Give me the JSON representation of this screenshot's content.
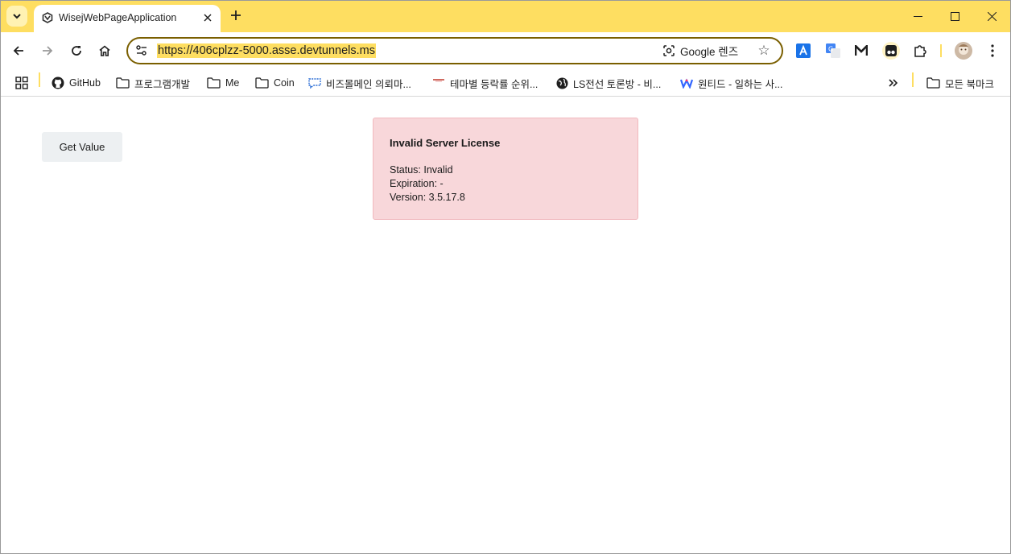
{
  "browser": {
    "tab": {
      "title": "WisejWebPageApplication"
    },
    "address_bar": {
      "url": "https://406cplzz-5000.asse.devtunnels.ms",
      "lens_label": "Google 렌즈"
    },
    "bookmarks": [
      {
        "label": "GitHub",
        "icon": "github-icon"
      },
      {
        "label": "프로그램개발",
        "icon": "folder-icon"
      },
      {
        "label": "Me",
        "icon": "folder-icon"
      },
      {
        "label": "Coin",
        "icon": "folder-icon"
      },
      {
        "label": "비즈몰메인 의뢰마...",
        "icon": "bizmall-icon"
      },
      {
        "label": "테마별 등락률 순위...",
        "icon": "site-icon"
      },
      {
        "label": "LS전선 토론방 - 비...",
        "icon": "globe-icon"
      },
      {
        "label": "원티드 - 일하는 사...",
        "icon": "wanted-icon"
      }
    ],
    "all_bookmarks_label": "모든 북마크",
    "accent_color": "#fede61"
  },
  "page": {
    "get_value_button": "Get Value",
    "license_alert": {
      "title": "Invalid Server License",
      "status": "Status: Invalid",
      "expiration": "Expiration: -",
      "version": "Version: 3.5.17.8",
      "background_color": "#f8d7da"
    }
  }
}
